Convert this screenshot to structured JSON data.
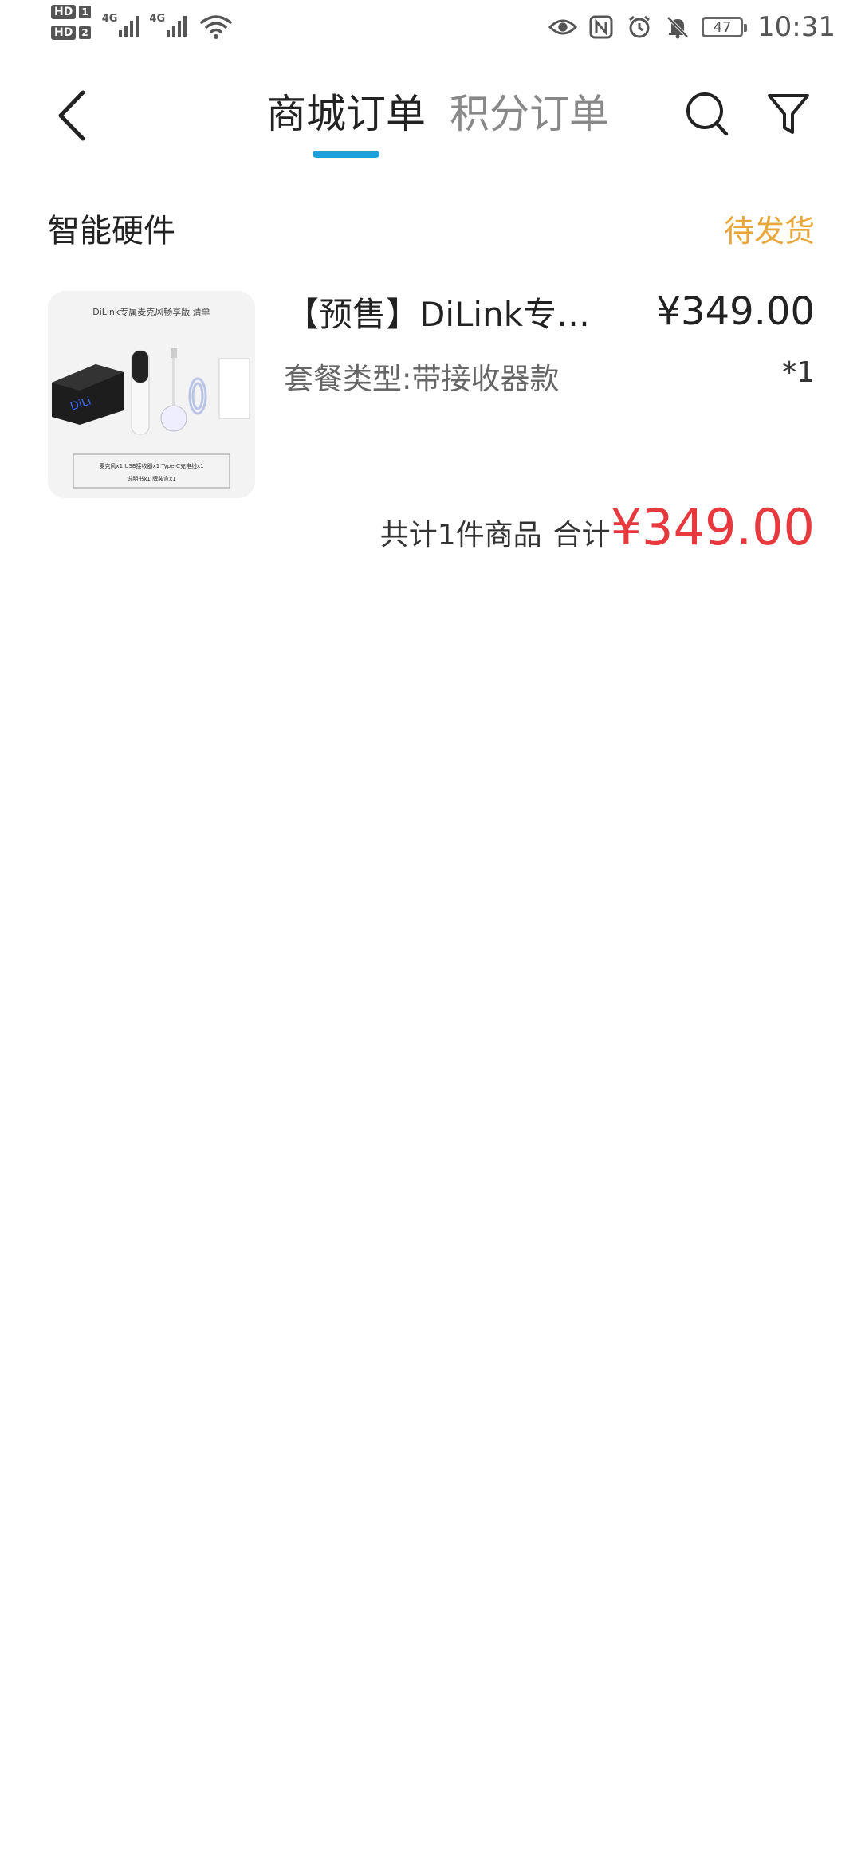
{
  "status_bar": {
    "sim1_label": "HD",
    "sim1_num": "1",
    "sim2_label": "HD",
    "sim2_num": "2",
    "network1": "4G",
    "network2": "4G",
    "battery": "47",
    "time": "10:31",
    "icons": [
      "eye-icon",
      "nfc-icon",
      "alarm-icon",
      "mute-bell-icon",
      "battery-icon"
    ]
  },
  "nav": {
    "tabs": [
      {
        "label": "商城订单",
        "active": true
      },
      {
        "label": "积分订单",
        "active": false
      }
    ],
    "icons": [
      "back-arrow-icon",
      "search-icon",
      "filter-icon"
    ],
    "accent": "#1ea0d8"
  },
  "order": {
    "shop_name": "智能硬件",
    "status": "待发货",
    "status_color": "#e9a63a",
    "product": {
      "thumb_title": "DiLink专属麦克风畅享版 清单",
      "thumb_items_1": "麦克风x1    USB接收器x1    Type-C充电线x1",
      "thumb_items_2": "说明书x1    牌装盒x1",
      "title": "【预售】DiLink专属...",
      "price": "¥349.00",
      "spec": "套餐类型:带接收器款",
      "qty": "*1"
    },
    "summary": {
      "count": "共计1件商品",
      "label": "合计",
      "total": "¥349.00",
      "total_color": "#e8393f"
    }
  }
}
